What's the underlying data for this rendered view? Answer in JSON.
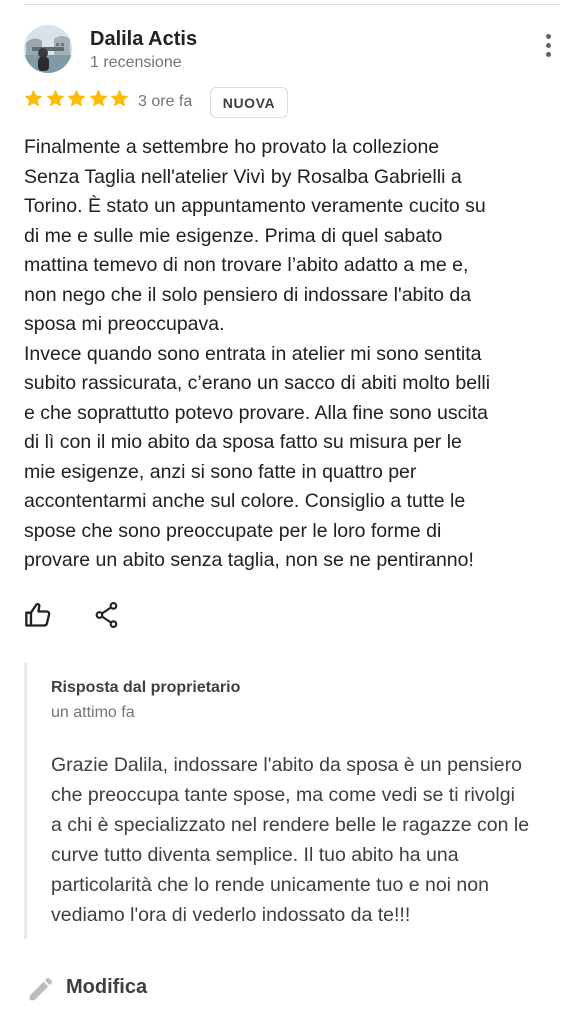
{
  "review": {
    "author_name": "Dalila Actis",
    "author_review_count": "1 recensione",
    "rating": 5,
    "max_rating": 5,
    "time_ago": "3 ore fa",
    "badge": "NUOVA",
    "text_lines": [
      "Finalmente a settembre ho provato la collezione",
      "Senza Taglia nell'atelier Vivì by Rosalba Gabrielli a",
      "Torino. È stato un appuntamento veramente cucito su",
      "di me e sulle mie esigenze. Prima di quel sabato",
      "mattina temevo di non trovare l’abito adatto a me e,",
      "non nego che il solo pensiero di indossare l'abito da",
      "sposa mi preoccupava.",
      "Invece quando sono entrata in atelier mi sono sentita",
      "subito rassicurata, c’erano un sacco di abiti molto belli",
      "e che soprattutto potevo provare. Alla fine sono uscita",
      "di lì con il mio abito da sposa fatto su misura per le",
      "mie esigenze, anzi si sono fatte in quattro per",
      "accontentarmi anche sul colore. Consiglio a tutte le",
      "spose che sono preoccupate per le loro forme di",
      "provare un abito senza taglia, non se ne pentiranno!"
    ]
  },
  "actions": {
    "like_icon": "thumb-up-outline-icon",
    "share_icon": "share-icon",
    "more_icon": "more-vert-icon"
  },
  "owner_reply": {
    "title": "Risposta dal proprietario",
    "time_ago": "un attimo fa",
    "text_lines": [
      "Grazie Dalila, indossare l'abito da sposa è un pensiero",
      "che preoccupa tante spose, ma come vedi se ti rivolgi",
      "a chi è specializzato nel rendere belle le ragazze con le",
      "curve tutto diventa semplice. Il tuo abito ha una",
      "particolarità che lo rende unicamente tuo e noi non",
      "vediamo l'ora di vederlo indossato da te!!!"
    ]
  },
  "edit": {
    "label": "Modifica",
    "icon": "pencil-icon"
  },
  "colors": {
    "star": "#fbbc04",
    "text_primary": "#202124",
    "text_secondary": "#70757a",
    "icon": "#5f6368",
    "reply_bar": "#e8eaed"
  }
}
